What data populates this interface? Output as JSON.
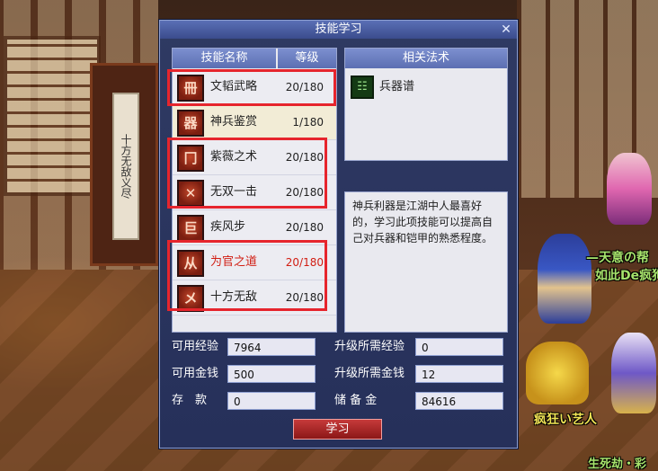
{
  "scene": {
    "shrine_text": "十方无敌义尽",
    "npc_labels": [
      "—天意の帮",
      "如此De疯狗",
      "疯狂い艺人",
      "生死劫・彩"
    ]
  },
  "dialog": {
    "title": "技能学习",
    "close_icon": "close-icon",
    "skill_list": {
      "header_name": "技能名称",
      "header_level": "等级",
      "skills": [
        {
          "name": "文韬武略",
          "level": "20/180",
          "icon": "skill-icon-wentao"
        },
        {
          "name": "神兵鉴赏",
          "level": "1/180",
          "icon": "skill-icon-shenbing"
        },
        {
          "name": "紫薇之术",
          "level": "20/180",
          "icon": "skill-icon-ziwei"
        },
        {
          "name": "无双一击",
          "level": "20/180",
          "icon": "skill-icon-wushuang"
        },
        {
          "name": "疾风步",
          "level": "20/180",
          "icon": "skill-icon-jifeng"
        },
        {
          "name": "为官之道",
          "level": "20/180",
          "icon": "skill-icon-weiguan"
        },
        {
          "name": "十方无敌",
          "level": "20/180",
          "icon": "skill-icon-shifang"
        }
      ]
    },
    "related": {
      "header": "相关法术",
      "items": [
        {
          "name": "兵器谱",
          "icon": "spell-icon-bingqipu"
        }
      ]
    },
    "description": "神兵利器是江湖中人最喜好的，学习此项技能可以提高自己对兵器和铠甲的熟悉程度。",
    "stats": {
      "avail_exp_label": "可用经验",
      "avail_exp_value": "7964",
      "need_exp_label": "升级所需经验",
      "need_exp_value": "0",
      "avail_money_label": "可用金钱",
      "avail_money_value": "500",
      "need_money_label": "升级所需金钱",
      "need_money_value": "12",
      "deposit_label": "存　款",
      "deposit_value": "0",
      "reserve_label": "储 备 金",
      "reserve_value": "84616"
    },
    "learn_button": "学习"
  },
  "colors": {
    "highlight_box": "#e6252d",
    "red_skill_text": "#d11d12",
    "panel_header": "#7c8fcf",
    "dialog_bg": "#2f3a63"
  }
}
